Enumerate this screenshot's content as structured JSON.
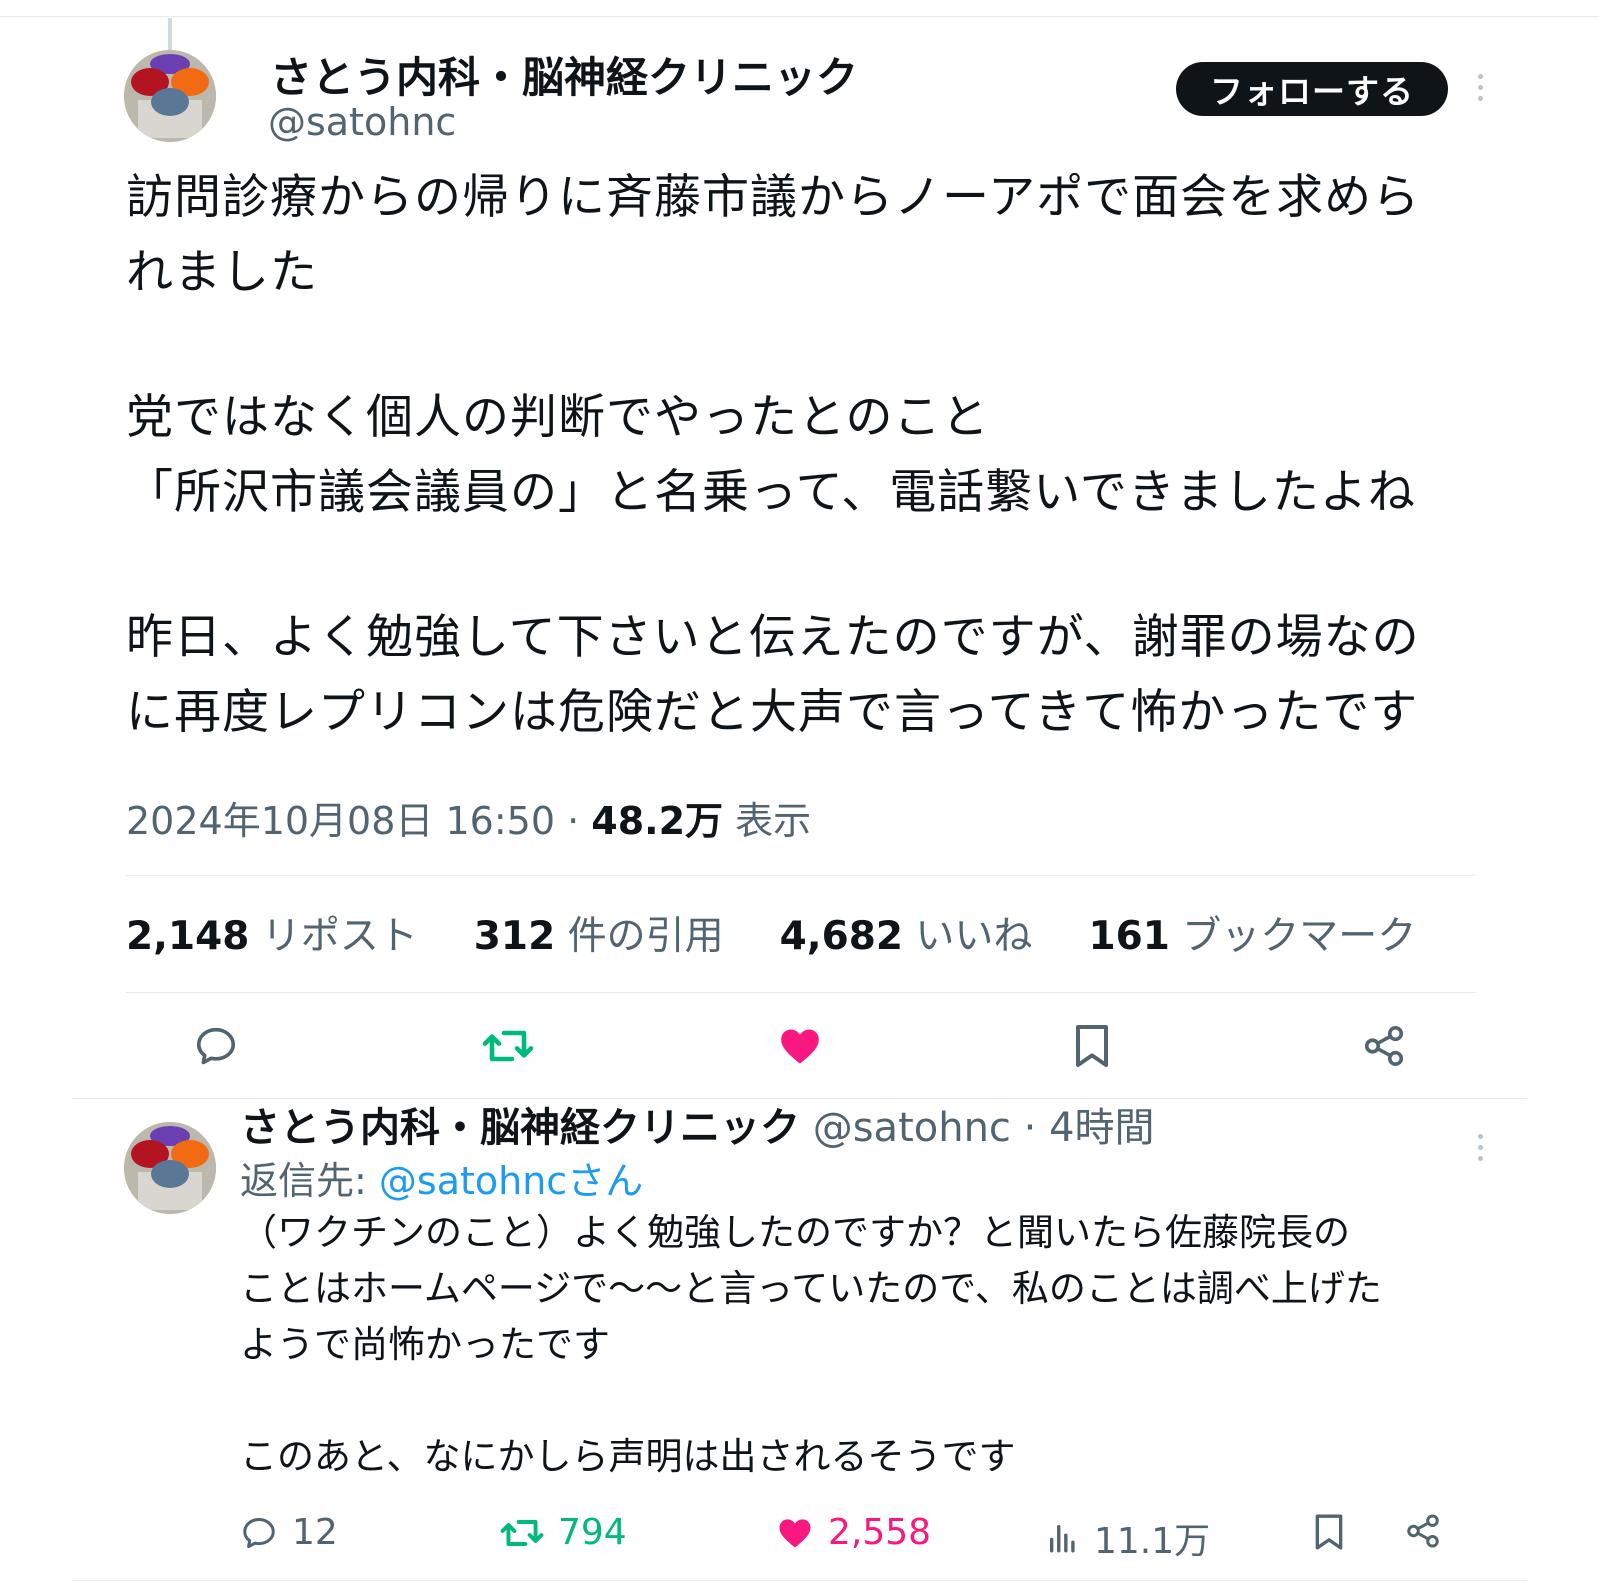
{
  "main_tweet": {
    "author_name": "さとう内科・脳神経クリニック",
    "author_handle": "@satohnc",
    "follow_label": "フォローする",
    "text": {
      "p1_line1": "訪問診療からの帰りに斉藤市議からノーアポで面会を求めら",
      "p1_line2": "れました",
      "p2_line1": "党ではなく個人の判断でやったとのこと",
      "p2_line2": "「所沢市議会議員の」と名乗って、電話繋いできましたよね",
      "p3_line1": "昨日、よく勉強して下さいと伝えたのですが、謝罪の場なの",
      "p3_line2": "に再度レプリコンは危険だと大声で言ってきて怖かったです"
    },
    "timestamp": "2024年10月08日 16:50",
    "separator": "·",
    "views_count": "48.2万",
    "views_label": "表示",
    "stats": {
      "reposts_count": "2,148",
      "reposts_label": "リポスト",
      "quotes_count": "312",
      "quotes_label": "件の引用",
      "likes_count": "4,682",
      "likes_label": "いいね",
      "bookmarks_count": "161",
      "bookmarks_label": "ブックマーク"
    },
    "actions": [
      "reply-icon",
      "repost-icon",
      "like-icon",
      "bookmark-icon",
      "share-icon"
    ]
  },
  "reply_tweet": {
    "author_name": "さとう内科・脳神経クリニック",
    "author_handle": "@satohnc",
    "separator": "·",
    "time_ago": "4時間",
    "reply_prefix": "返信先:",
    "reply_mention": "@satohncさん",
    "text": {
      "line1": "（ワクチンのこと）よく勉強したのですか？と聞いたら佐藤院長の",
      "line2": "ことはホームページで〜〜と言っていたので、私のことは調べ上げた",
      "line3": "ようで尚怖かったです",
      "line4": "このあと、なにかしら声明は出されるそうです"
    },
    "replies": "12",
    "reposts": "794",
    "likes": "2,558",
    "views": "11.1万"
  },
  "colors": {
    "text": "#0f1419",
    "secondary": "#536471",
    "repost_green": "#00ba7c",
    "like_pink": "#f91880",
    "link_blue": "#1d9bf0",
    "divider": "#e7e9ec"
  }
}
